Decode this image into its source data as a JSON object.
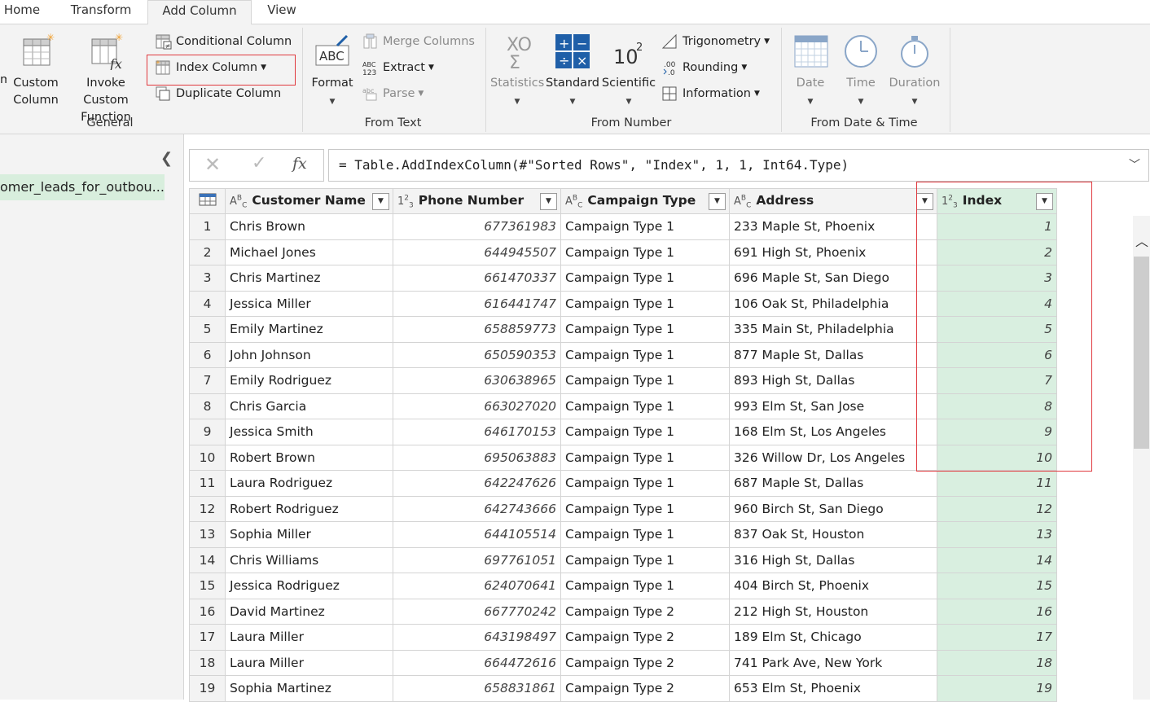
{
  "tabs": [
    {
      "label": "Home"
    },
    {
      "label": "Transform"
    },
    {
      "label": "Add Column"
    },
    {
      "label": "View"
    }
  ],
  "ribbon": {
    "general": {
      "label": "General",
      "custom_column": "Custom Column",
      "invoke_custom_function": "Invoke Custom Function",
      "conditional_column": "Conditional Column",
      "index_column": "Index Column",
      "duplicate_column": "Duplicate Column"
    },
    "from_text": {
      "label": "From Text",
      "format": "Format",
      "merge_columns": "Merge Columns",
      "extract": "Extract",
      "parse": "Parse"
    },
    "from_number": {
      "label": "From Number",
      "statistics": "Statistics",
      "standard": "Standard",
      "scientific": "Scientific",
      "trigonometry": "Trigonometry",
      "rounding": "Rounding",
      "information": "Information"
    },
    "from_date_time": {
      "label": "From Date & Time",
      "date": "Date",
      "time": "Time",
      "duration": "Duration"
    }
  },
  "queries": {
    "item": "omer_leads_for_outbou..."
  },
  "formula_bar": {
    "formula": "= Table.AddIndexColumn(#\"Sorted Rows\", \"Index\", 1, 1, Int64.Type)"
  },
  "table": {
    "columns": [
      {
        "type": "ABC",
        "name": "Customer Name"
      },
      {
        "type": "123",
        "name": "Phone Number"
      },
      {
        "type": "ABC",
        "name": "Campaign Type"
      },
      {
        "type": "ABC",
        "name": "Address"
      },
      {
        "type": "123",
        "name": "Index"
      }
    ],
    "rows": [
      [
        "1",
        "Chris Brown",
        "677361983",
        "Campaign Type 1",
        "233 Maple St, Phoenix",
        "1"
      ],
      [
        "2",
        "Michael Jones",
        "644945507",
        "Campaign Type 1",
        "691 High St, Phoenix",
        "2"
      ],
      [
        "3",
        "Chris Martinez",
        "661470337",
        "Campaign Type 1",
        "696 Maple St, San Diego",
        "3"
      ],
      [
        "4",
        "Jessica Miller",
        "616441747",
        "Campaign Type 1",
        "106 Oak St, Philadelphia",
        "4"
      ],
      [
        "5",
        "Emily Martinez",
        "658859773",
        "Campaign Type 1",
        "335 Main St, Philadelphia",
        "5"
      ],
      [
        "6",
        "John Johnson",
        "650590353",
        "Campaign Type 1",
        "877 Maple St, Dallas",
        "6"
      ],
      [
        "7",
        "Emily Rodriguez",
        "630638965",
        "Campaign Type 1",
        "893 High St, Dallas",
        "7"
      ],
      [
        "8",
        "Chris Garcia",
        "663027020",
        "Campaign Type 1",
        "993 Elm St, San Jose",
        "8"
      ],
      [
        "9",
        "Jessica Smith",
        "646170153",
        "Campaign Type 1",
        "168 Elm St, Los Angeles",
        "9"
      ],
      [
        "10",
        "Robert Brown",
        "695063883",
        "Campaign Type 1",
        "326 Willow Dr, Los Angeles",
        "10"
      ],
      [
        "11",
        "Laura Rodriguez",
        "642247626",
        "Campaign Type 1",
        "687 Maple St, Dallas",
        "11"
      ],
      [
        "12",
        "Robert Rodriguez",
        "642743666",
        "Campaign Type 1",
        "960 Birch St, San Diego",
        "12"
      ],
      [
        "13",
        "Sophia Miller",
        "644105514",
        "Campaign Type 1",
        "837 Oak St, Houston",
        "13"
      ],
      [
        "14",
        "Chris Williams",
        "697761051",
        "Campaign Type 1",
        "316 High St, Dallas",
        "14"
      ],
      [
        "15",
        "Jessica Rodriguez",
        "624070641",
        "Campaign Type 1",
        "404 Birch St, Phoenix",
        "15"
      ],
      [
        "16",
        "David Martinez",
        "667770242",
        "Campaign Type 2",
        "212 High St, Houston",
        "16"
      ],
      [
        "17",
        "Laura Miller",
        "643198497",
        "Campaign Type 2",
        "189 Elm St, Chicago",
        "17"
      ],
      [
        "18",
        "Laura Miller",
        "664472616",
        "Campaign Type 2",
        "741 Park Ave, New York",
        "18"
      ],
      [
        "19",
        "Sophia Martinez",
        "658831861",
        "Campaign Type 2",
        "653 Elm St, Phoenix",
        "19"
      ]
    ]
  },
  "colors": {
    "highlight_box": "#e0393e",
    "index_column_fill": "#d9efe0",
    "query_selected": "#d8eedd"
  }
}
